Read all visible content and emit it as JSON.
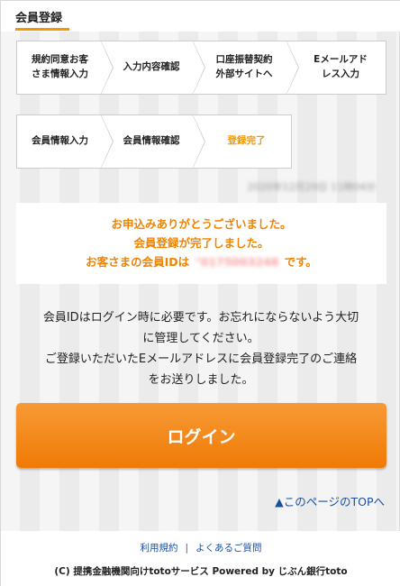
{
  "header": {
    "title": "会員登録"
  },
  "steps_row1": [
    {
      "line1": "規約同意お客",
      "line2": "さま情報入力",
      "active": false
    },
    {
      "line1": "入力内容確認",
      "line2": "",
      "active": false
    },
    {
      "line1": "口座振替契約",
      "line2": "外部サイトへ",
      "active": false
    },
    {
      "line1": "Eメールアド",
      "line2": "レス入力",
      "active": false
    }
  ],
  "steps_row2": [
    {
      "line1": "会員情報入力",
      "line2": "",
      "active": false
    },
    {
      "line1": "会員情報確認",
      "line2": "",
      "active": false
    },
    {
      "line1": "登録完了",
      "line2": "",
      "active": true
    }
  ],
  "timestamp": "2020年12月29日 11時04分",
  "message": {
    "line1": "お申込みありがとうございました。",
    "line2": "会員登録が完了しました。",
    "line3_prefix": "お客さまの会員IDは",
    "member_id": "\"0175003248",
    "line3_suffix": "です。"
  },
  "body": {
    "line1": "会員IDはログイン時に必要です。お忘れにならないよう大切",
    "line2": "に管理してください。",
    "line3": "ご登録いただいたEメールアドレスに会員登録完了のご連絡",
    "line4": "をお送りしました。"
  },
  "login_button": {
    "label": "ログイン"
  },
  "page_top_link": {
    "label": "▲このページのTOPへ"
  },
  "footer": {
    "terms_label": "利用規約",
    "separator": "|",
    "faq_label": "よくあるご質問",
    "copyright": "(C) 提携金融機関向けtotoサービス Powered by じぶん銀行toto"
  },
  "colors": {
    "accent": "#f39800",
    "link": "#1a4fa0"
  }
}
